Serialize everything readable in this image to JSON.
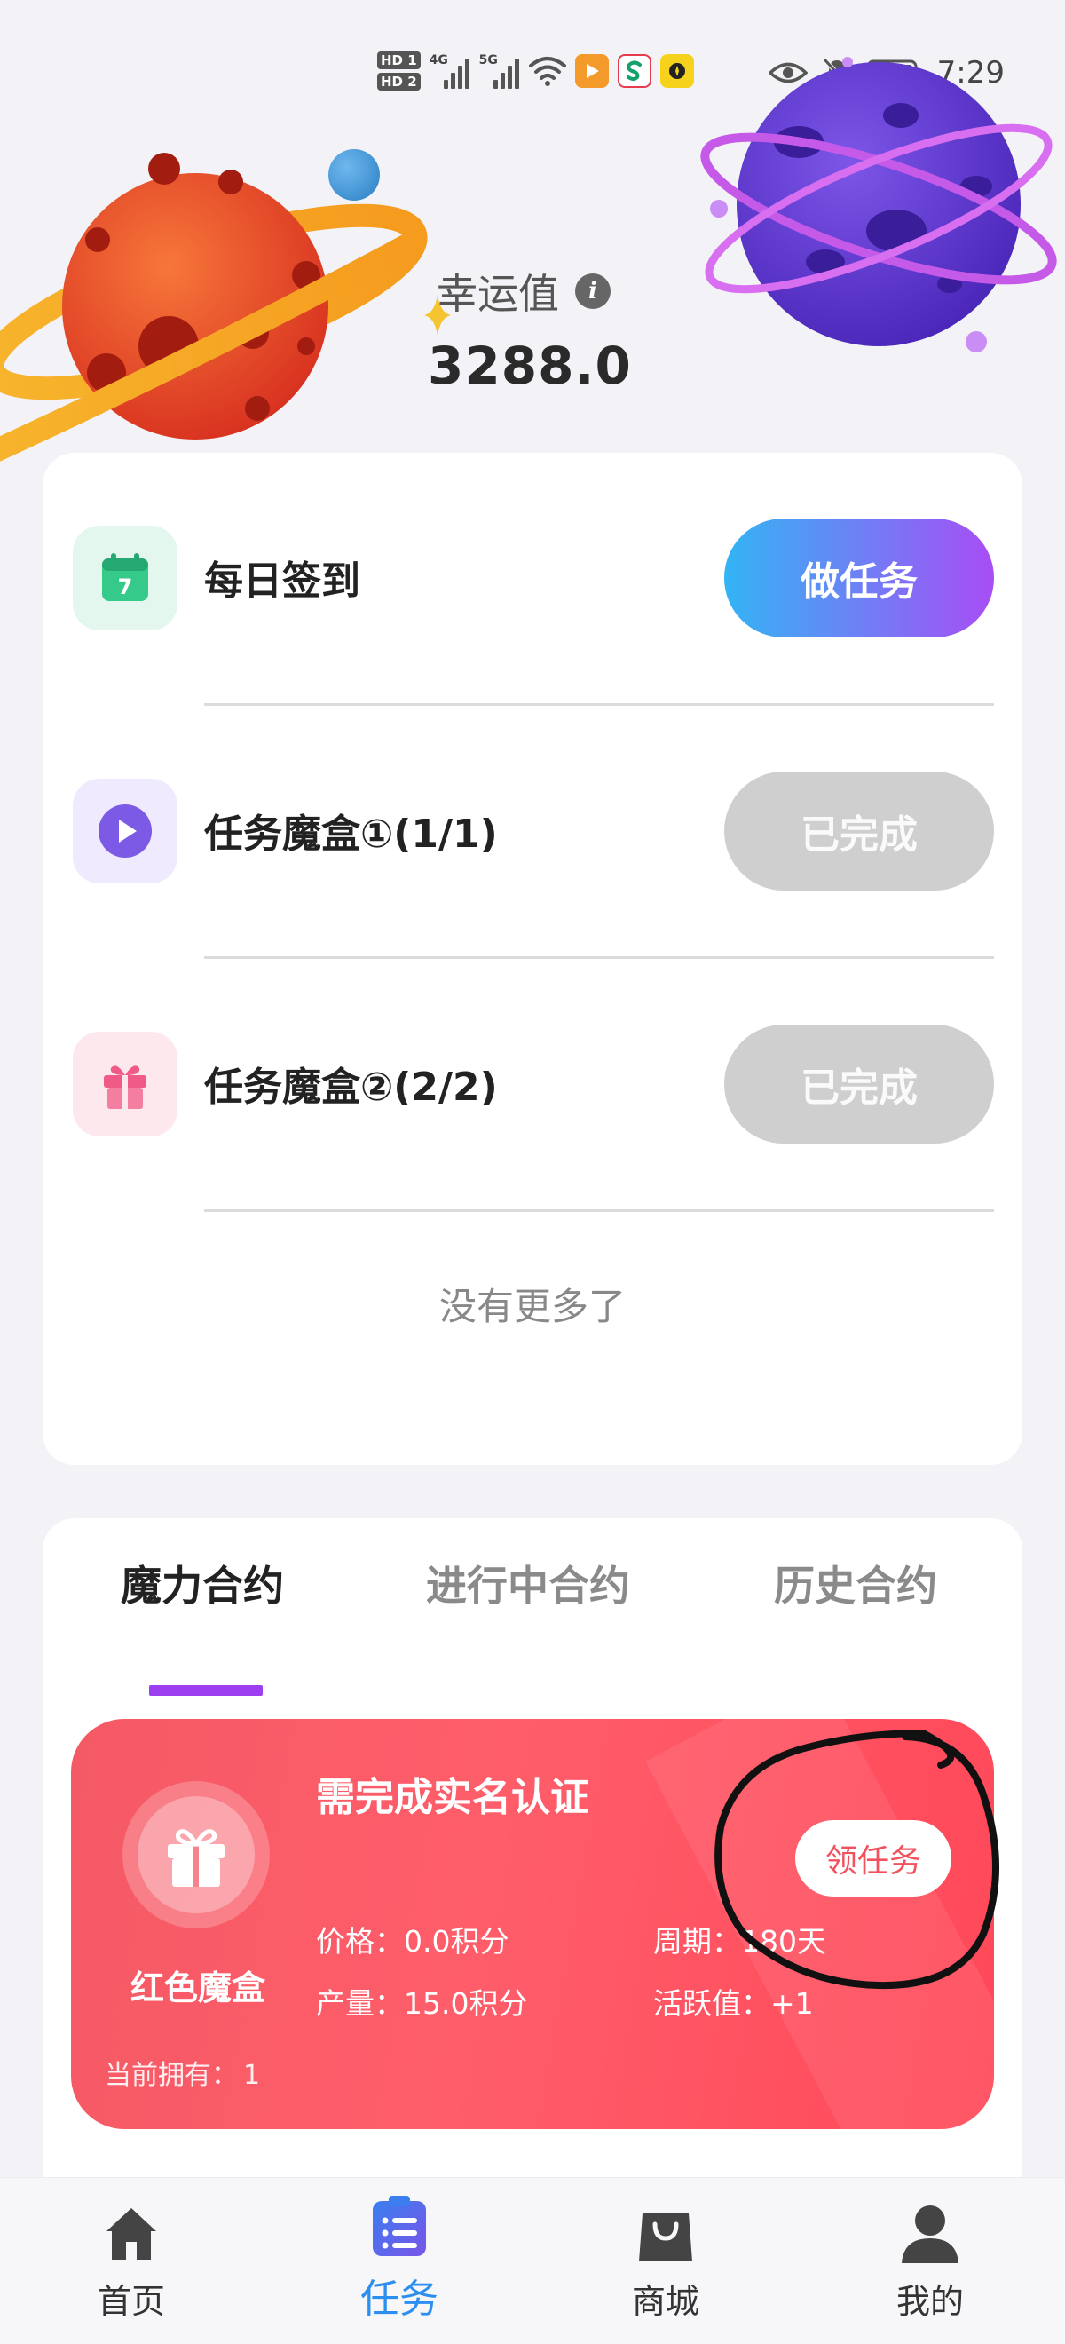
{
  "status_bar": {
    "hd1": "HD 1",
    "hd2": "HD 2",
    "gen1": "4G",
    "gen2": "5G",
    "time": "7:29"
  },
  "header": {
    "luck_label": "幸运值",
    "luck_value": "3288.0"
  },
  "tasks": [
    {
      "title": "每日签到",
      "button": "做任务",
      "state": "todo",
      "icon": "calendar-icon",
      "icon_text": "7"
    },
    {
      "title": "任务魔盒①(1/1)",
      "button": "已完成",
      "state": "done",
      "icon": "play-icon"
    },
    {
      "title": "任务魔盒②(2/2)",
      "button": "已完成",
      "state": "done",
      "icon": "gift-icon"
    }
  ],
  "no_more_text": "没有更多了",
  "contract_tabs": [
    {
      "label": "魔力合约",
      "active": true
    },
    {
      "label": "进行中合约",
      "active": false
    },
    {
      "label": "历史合约",
      "active": false
    }
  ],
  "magic_box": {
    "title": "需完成实名认证",
    "name": "红色魔盒",
    "owned_label": "当前拥有：",
    "owned_value": "1",
    "claim_button": "领任务",
    "price": "价格：0.0积分",
    "period": "周期：180天",
    "output": "产量：15.0积分",
    "activity": "活跃值：+1"
  },
  "bottom_nav": [
    {
      "label": "首页",
      "icon": "home-icon",
      "active": false
    },
    {
      "label": "任务",
      "icon": "task-list-icon",
      "active": true
    },
    {
      "label": "商城",
      "icon": "shopping-bag-icon",
      "active": false
    },
    {
      "label": "我的",
      "icon": "profile-icon",
      "active": false
    }
  ],
  "colors": {
    "accent_gradient_start": "#33b4f5",
    "accent_gradient_end": "#a84df5",
    "active_tab_underline": "#9b3ff0",
    "magic_box_red": "#ff5d6a",
    "nav_active": "#2c8ff0"
  }
}
